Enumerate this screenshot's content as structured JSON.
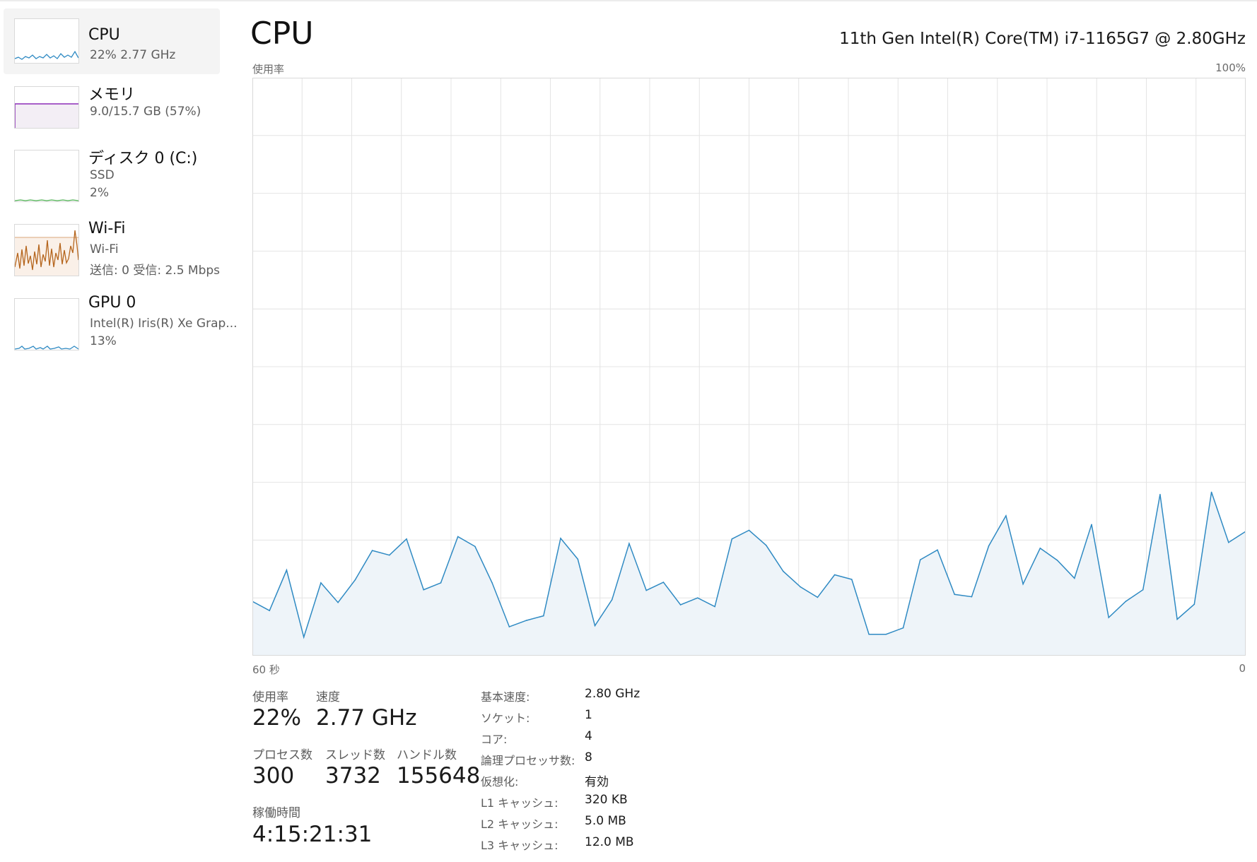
{
  "sidebar": {
    "items": [
      {
        "name": "CPU",
        "line1": "22%  2.77 GHz",
        "line2": ""
      },
      {
        "name": "メモリ",
        "line1": "9.0/15.7 GB (57%)",
        "line2": ""
      },
      {
        "name": "ディスク 0 (C:)",
        "line1": "SSD",
        "line2": "2%"
      },
      {
        "name": "Wi-Fi",
        "line1": "Wi-Fi",
        "line2": "送信: 0  受信: 2.5 Mbps"
      },
      {
        "name": "GPU 0",
        "line1": "Intel(R) Iris(R) Xe Grap...",
        "line2": "13%"
      }
    ]
  },
  "main": {
    "title": "CPU",
    "processor": "11th Gen Intel(R) Core(TM) i7-1165G7 @ 2.80GHz",
    "graph": {
      "y_label": "使用率",
      "y_max_label": "100%",
      "x_left_label": "60 秒",
      "x_right_label": "0"
    },
    "stats": {
      "usage_label": "使用率",
      "usage_value": "22%",
      "speed_label": "速度",
      "speed_value": "2.77 GHz",
      "processes_label": "プロセス数",
      "processes_value": "300",
      "threads_label": "スレッド数",
      "threads_value": "3732",
      "handles_label": "ハンドル数",
      "handles_value": "155648",
      "uptime_label": "稼働時間",
      "uptime_value": "4:15:21:31"
    },
    "specs": [
      {
        "k": "基本速度:",
        "v": "2.80 GHz"
      },
      {
        "k": "ソケット:",
        "v": "1"
      },
      {
        "k": "コア:",
        "v": "4"
      },
      {
        "k": "論理プロセッサ数:",
        "v": "8"
      },
      {
        "k": "仮想化:",
        "v": "有効"
      },
      {
        "k": "L1 キャッシュ:",
        "v": "320 KB"
      },
      {
        "k": "L2 キャッシュ:",
        "v": "5.0 MB"
      },
      {
        "k": "L3 キャッシュ:",
        "v": "12.0 MB"
      }
    ]
  },
  "colors": {
    "cpu_line": "#2f8ac3",
    "cpu_fill": "#eef4f9",
    "memory": "#8c2db8",
    "disk": "#4caf50",
    "wifi": "#b5651d",
    "gpu": "#2f8ac3",
    "grid": "#e4e4e4"
  },
  "chart_data": {
    "type": "area",
    "title": "CPU",
    "ylabel": "使用率",
    "ylim": [
      0,
      100
    ],
    "x": [
      60,
      59,
      58,
      57,
      56,
      55,
      54,
      53,
      52,
      51,
      50,
      49,
      48,
      47,
      46,
      45,
      44,
      43,
      42,
      41,
      40,
      39,
      38,
      37,
      36,
      35,
      34,
      33,
      32,
      31,
      30,
      29,
      28,
      27,
      26,
      25,
      24,
      23,
      22,
      21,
      20,
      19,
      18,
      17,
      16,
      15,
      14,
      13,
      12,
      11,
      10,
      9,
      8,
      7,
      6,
      5,
      4,
      3,
      2,
      1,
      0
    ],
    "series": [
      {
        "values": [
          9.4,
          7.8,
          14.8,
          3.2,
          12.6,
          9.2,
          13.1,
          18.2,
          17.4,
          20.2,
          11.4,
          12.6,
          20.6,
          18.9,
          12.6,
          5.0,
          6.1,
          6.9,
          20.3,
          16.7,
          5.2,
          9.7,
          19.4,
          11.3,
          12.7,
          8.8,
          10.0,
          8.5,
          20.2,
          21.7,
          19.1,
          14.6,
          11.9,
          10.1,
          14.0,
          13.2,
          3.7,
          3.7,
          4.8,
          16.6,
          18.3,
          10.6,
          10.2,
          19.0,
          24.2,
          12.4,
          18.6,
          16.5,
          13.4,
          22.7,
          6.6,
          9.4,
          11.4,
          27.9,
          6.3,
          8.9,
          28.3,
          19.6,
          21.5
        ]
      }
    ]
  }
}
